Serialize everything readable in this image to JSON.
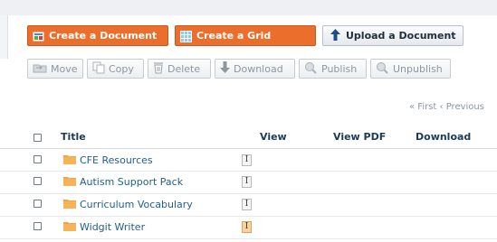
{
  "toolbar": {
    "create_document": "Create a Document",
    "create_grid": "Create a Grid",
    "upload_document": "Upload a Document",
    "move": "Move",
    "copy": "Copy",
    "delete": "Delete",
    "download": "Download",
    "publish": "Publish",
    "unpublish": "Unpublish"
  },
  "pager": {
    "text": "« First  ‹ Previous"
  },
  "table": {
    "headers": {
      "title": "Title",
      "view": "View",
      "view_pdf": "View PDF",
      "download": "Download"
    },
    "rows": [
      {
        "title": "CFE Resources",
        "view_icon": "text-cursor-icon"
      },
      {
        "title": "Autism Support Pack",
        "view_icon": "text-cursor-icon"
      },
      {
        "title": "Curriculum Vocabulary",
        "view_icon": "text-cursor-icon"
      },
      {
        "title": "Widgit Writer",
        "view_icon": "text-cursor-icon-highlighted"
      }
    ]
  },
  "colors": {
    "primary_orange": "#ec6e2c",
    "folder_orange": "#f4a340",
    "link_blue": "#1f5f8b",
    "header_navy": "#1d3a57",
    "disabled_gray": "#8f969e"
  }
}
